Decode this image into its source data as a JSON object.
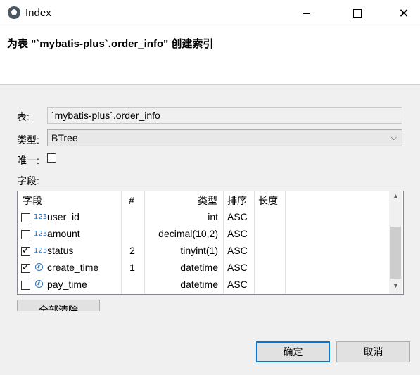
{
  "window": {
    "title": "Index"
  },
  "header": {
    "title": "为表 \"`mybatis-plus`.order_info\" 创建索引"
  },
  "form": {
    "table_label": "表:",
    "table_value": "`mybatis-plus`.order_info",
    "type_label": "类型:",
    "type_value": "BTree",
    "unique_label": "唯一:",
    "unique_checked": false,
    "fields_label": "字段:"
  },
  "grid": {
    "columns": [
      "字段",
      "#",
      "类型",
      "排序",
      "长度"
    ],
    "rows": [
      {
        "checked": false,
        "icon": "numeric-icon",
        "name": "user_id",
        "order": "",
        "type": "int",
        "sort": "ASC",
        "length": ""
      },
      {
        "checked": false,
        "icon": "numeric-icon",
        "name": "amount",
        "order": "",
        "type": "decimal(10,2)",
        "sort": "ASC",
        "length": ""
      },
      {
        "checked": true,
        "icon": "numeric-icon",
        "name": "status",
        "order": "2",
        "type": "tinyint(1)",
        "sort": "ASC",
        "length": ""
      },
      {
        "checked": true,
        "icon": "clock-icon",
        "name": "create_time",
        "order": "1",
        "type": "datetime",
        "sort": "ASC",
        "length": ""
      },
      {
        "checked": false,
        "icon": "clock-icon",
        "name": "pay_time",
        "order": "",
        "type": "datetime",
        "sort": "ASC",
        "length": ""
      }
    ]
  },
  "buttons": {
    "clear_all": "全部清除",
    "ok": "确定",
    "cancel": "取消"
  },
  "icons": {
    "numeric_glyph": "123"
  },
  "colors": {
    "accent": "#0078d7",
    "icon_blue": "#2f6fb3"
  }
}
